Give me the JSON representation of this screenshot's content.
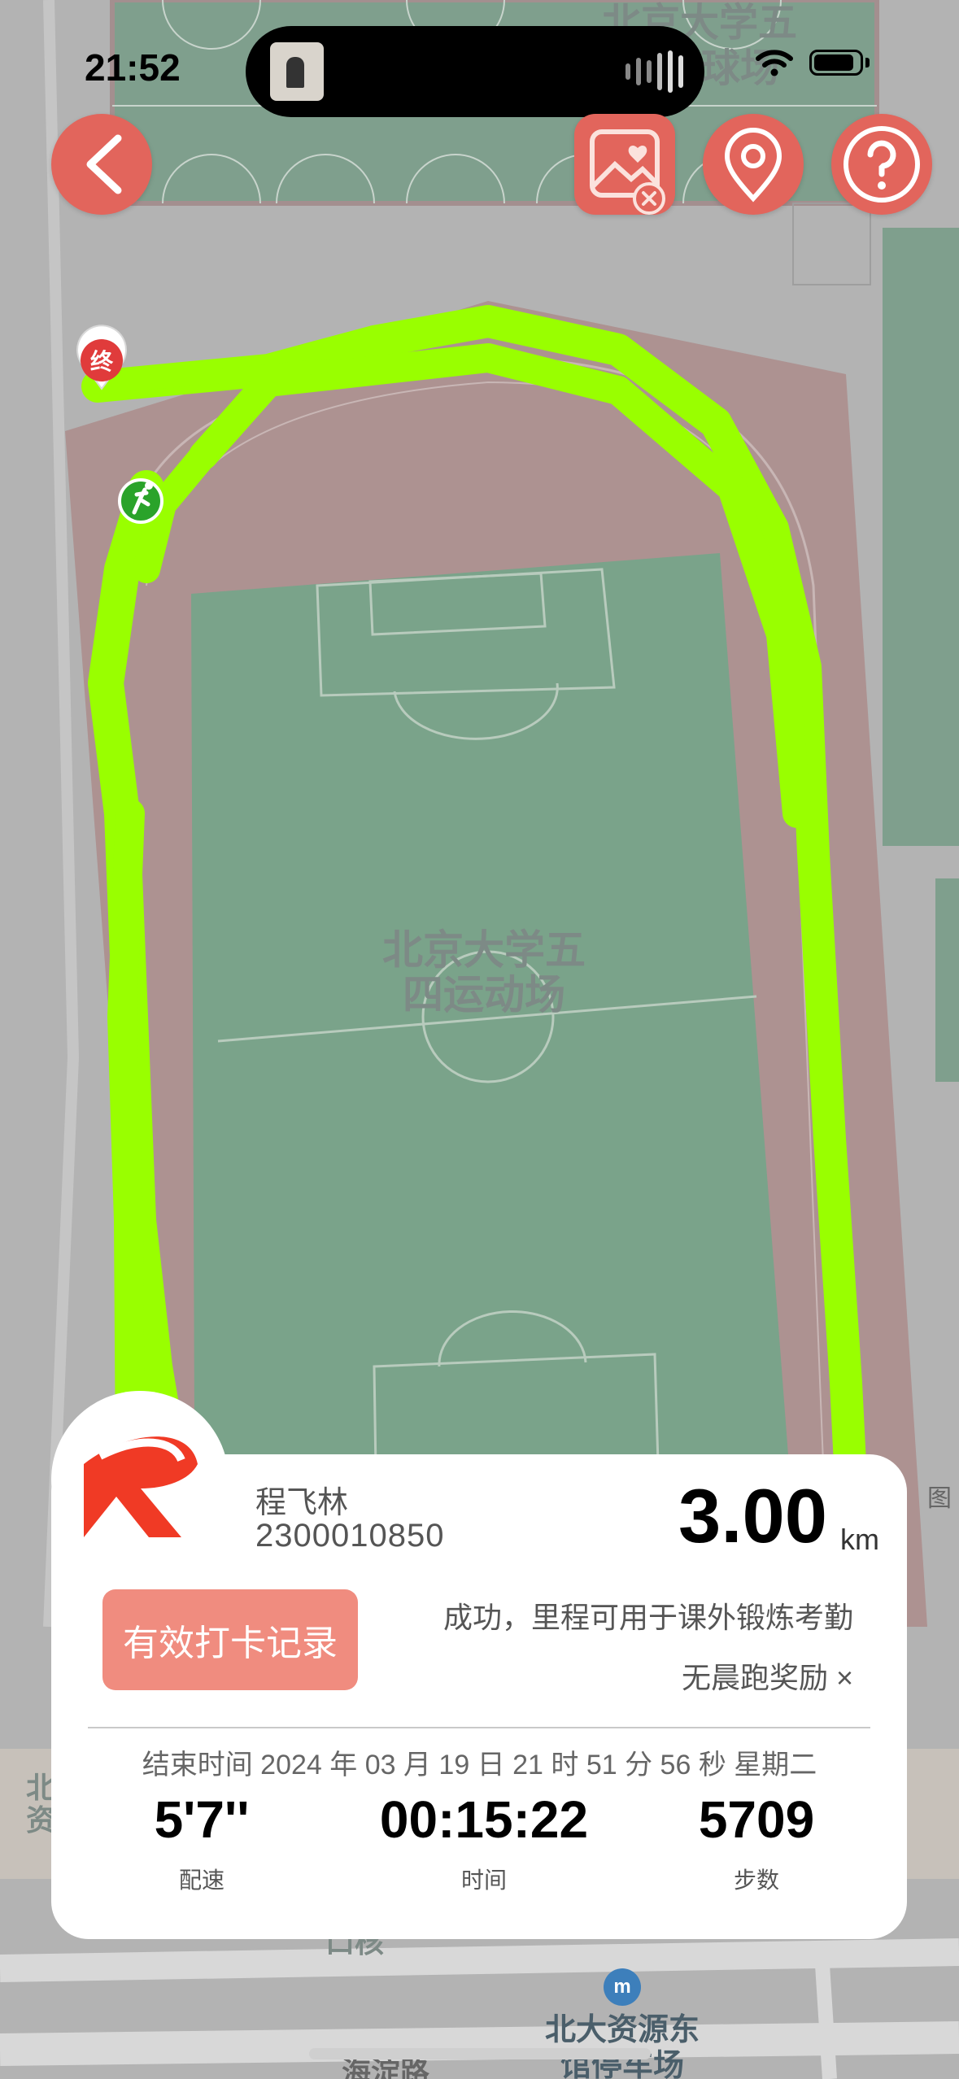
{
  "status_bar": {
    "time": "21:52"
  },
  "map": {
    "field_label_line1": "北京大学五",
    "field_label_line2": "四运动场",
    "court_label_line1": "北京大学五",
    "court_label_line2": "球场",
    "left_label_line1": "北",
    "left_label_line2": "资",
    "bottom_label_partial": "口核",
    "bus_stop_line1": "北大资源东",
    "bus_stop_line2": "馆停车场",
    "road_label": "海淀路",
    "map_credit": "图",
    "end_marker_text": "终",
    "bus_stop_icon_text": "m",
    "colors": {
      "track_path": "#99ff00",
      "running_track": "#ad9291",
      "field": "#7aa38a",
      "background": "#b3b3b3"
    }
  },
  "toolbar": {
    "back_icon": "chevron-left-icon",
    "photo_icon": "photo-heart-icon",
    "location_icon": "location-pin-icon",
    "help_icon": "question-mark-icon",
    "accent_color": "#e2655c"
  },
  "card": {
    "name": "程飞林",
    "student_id": "2300010850",
    "distance": "3.00",
    "distance_unit": "km",
    "record_button": "有效打卡记录",
    "success_message": "成功，里程可用于课外锻炼考勤",
    "morning_reward": "无晨跑奖励 ×",
    "end_time": "结束时间 2024 年 03 月 19 日 21 时 51 分 56 秒 星期二",
    "stats": [
      {
        "value": "5'7''",
        "label": "配速"
      },
      {
        "value": "00:15:22",
        "label": "时间"
      },
      {
        "value": "5709",
        "label": "步数"
      }
    ]
  }
}
